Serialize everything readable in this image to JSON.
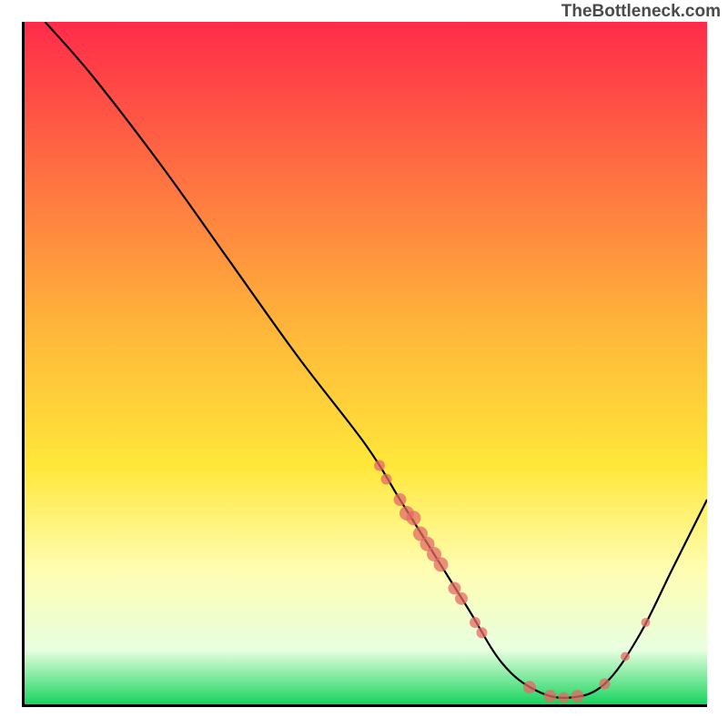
{
  "watermark": "TheBottleneck.com",
  "chart_data": {
    "type": "line",
    "title": "",
    "xlabel": "",
    "ylabel": "",
    "xlim": [
      0,
      100
    ],
    "ylim": [
      0,
      100
    ],
    "gradient": {
      "stops": [
        {
          "offset": 0,
          "color": "#ff2b49"
        },
        {
          "offset": 45,
          "color": "#ffb63a"
        },
        {
          "offset": 65,
          "color": "#ffe73a"
        },
        {
          "offset": 80,
          "color": "#fffdb0"
        },
        {
          "offset": 92,
          "color": "#e8ffe0"
        },
        {
          "offset": 100,
          "color": "#18d45e"
        }
      ]
    },
    "curve": [
      {
        "x": 3,
        "y": 100
      },
      {
        "x": 10,
        "y": 92
      },
      {
        "x": 20,
        "y": 79
      },
      {
        "x": 30,
        "y": 65
      },
      {
        "x": 40,
        "y": 51
      },
      {
        "x": 50,
        "y": 38
      },
      {
        "x": 55,
        "y": 30
      },
      {
        "x": 60,
        "y": 22
      },
      {
        "x": 65,
        "y": 14
      },
      {
        "x": 70,
        "y": 6
      },
      {
        "x": 75,
        "y": 2
      },
      {
        "x": 80,
        "y": 1
      },
      {
        "x": 85,
        "y": 3
      },
      {
        "x": 90,
        "y": 10
      },
      {
        "x": 95,
        "y": 20
      },
      {
        "x": 100,
        "y": 30
      }
    ],
    "markers": [
      {
        "x": 52,
        "y": 35,
        "r": 6
      },
      {
        "x": 53,
        "y": 33,
        "r": 6
      },
      {
        "x": 55,
        "y": 30,
        "r": 7
      },
      {
        "x": 56,
        "y": 28,
        "r": 8
      },
      {
        "x": 57,
        "y": 27.3,
        "r": 8
      },
      {
        "x": 58,
        "y": 25,
        "r": 8
      },
      {
        "x": 59,
        "y": 23.5,
        "r": 8
      },
      {
        "x": 60,
        "y": 22,
        "r": 8
      },
      {
        "x": 61,
        "y": 20.5,
        "r": 8
      },
      {
        "x": 63,
        "y": 17,
        "r": 7
      },
      {
        "x": 64,
        "y": 15.5,
        "r": 7
      },
      {
        "x": 66,
        "y": 12,
        "r": 6
      },
      {
        "x": 67,
        "y": 10.5,
        "r": 6
      },
      {
        "x": 74,
        "y": 2.5,
        "r": 7
      },
      {
        "x": 77,
        "y": 1.2,
        "r": 7
      },
      {
        "x": 79,
        "y": 1.0,
        "r": 6
      },
      {
        "x": 81,
        "y": 1.2,
        "r": 7
      },
      {
        "x": 85,
        "y": 3,
        "r": 6
      },
      {
        "x": 88,
        "y": 7,
        "r": 5
      },
      {
        "x": 91,
        "y": 12,
        "r": 5
      }
    ]
  }
}
